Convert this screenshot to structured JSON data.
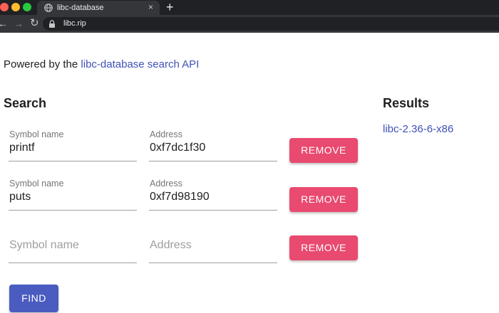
{
  "browser": {
    "tab_title": "libc-database",
    "tab_close": "×",
    "new_tab": "+",
    "url": "libc.rip",
    "back": "←",
    "forward": "→",
    "reload": "↻"
  },
  "intro": {
    "prefix": "Powered by the ",
    "link_text": "libc-database search API"
  },
  "search": {
    "title": "Search",
    "rows": [
      {
        "symbol_label": "Symbol name",
        "symbol_value": "printf",
        "address_label": "Address",
        "address_value": "0xf7dc1f30",
        "remove_label": "REMOVE"
      },
      {
        "symbol_label": "Symbol name",
        "symbol_value": "puts",
        "address_label": "Address",
        "address_value": "0xf7d98190",
        "remove_label": "REMOVE"
      },
      {
        "symbol_placeholder": "Symbol name",
        "address_placeholder": "Address",
        "remove_label": "REMOVE"
      }
    ],
    "find_label": "FIND"
  },
  "results": {
    "title": "Results",
    "items": [
      "libc-2.36-6-x86"
    ]
  },
  "colors": {
    "link": "#3f51b5",
    "remove_button": "#e94a6f",
    "find_button": "#4a5cc0"
  }
}
